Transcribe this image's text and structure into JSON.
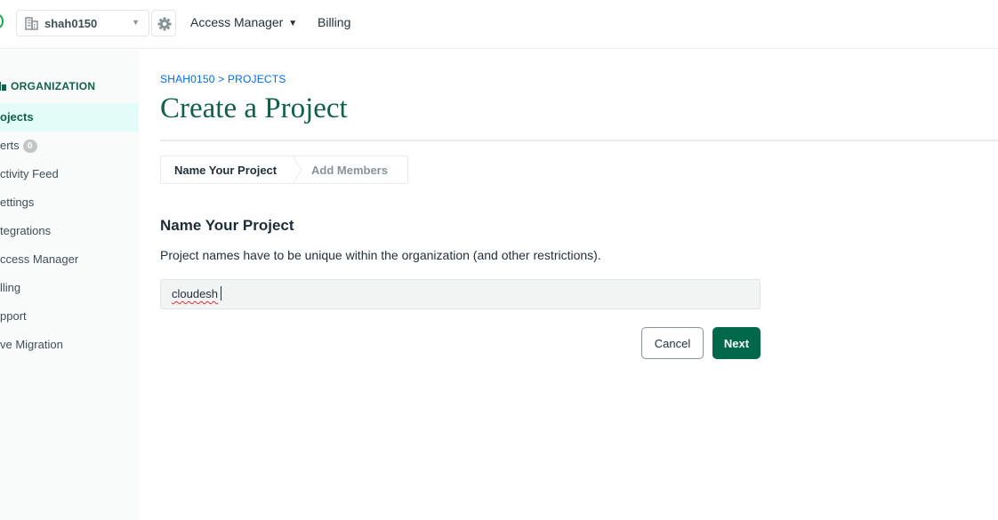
{
  "header": {
    "org_name": "shah0150",
    "access_manager_label": "Access Manager",
    "billing_label": "Billing"
  },
  "sidebar": {
    "heading": "ORGANIZATION",
    "items": [
      {
        "label": "ojects",
        "active": true
      },
      {
        "label": "erts",
        "badge": "0"
      },
      {
        "label": "ctivity Feed"
      },
      {
        "label": "ettings"
      },
      {
        "label": "tegrations"
      },
      {
        "label": "ccess Manager"
      },
      {
        "label": "lling"
      },
      {
        "label": "pport"
      },
      {
        "label": "ve Migration"
      }
    ]
  },
  "main": {
    "breadcrumb": "SHAH0150 > PROJECTS",
    "title": "Create a Project",
    "steps": [
      "Name Your Project",
      "Add Members"
    ],
    "section_title": "Name Your Project",
    "section_desc": "Project names have to be unique within the organization (and other restrictions).",
    "project_name_value": "cloudesh",
    "cancel_label": "Cancel",
    "next_label": "Next"
  },
  "colors": {
    "brand_green": "#116149",
    "button_green": "#00684a",
    "link_blue": "#016bf8",
    "active_bg": "#e3fcf7"
  }
}
